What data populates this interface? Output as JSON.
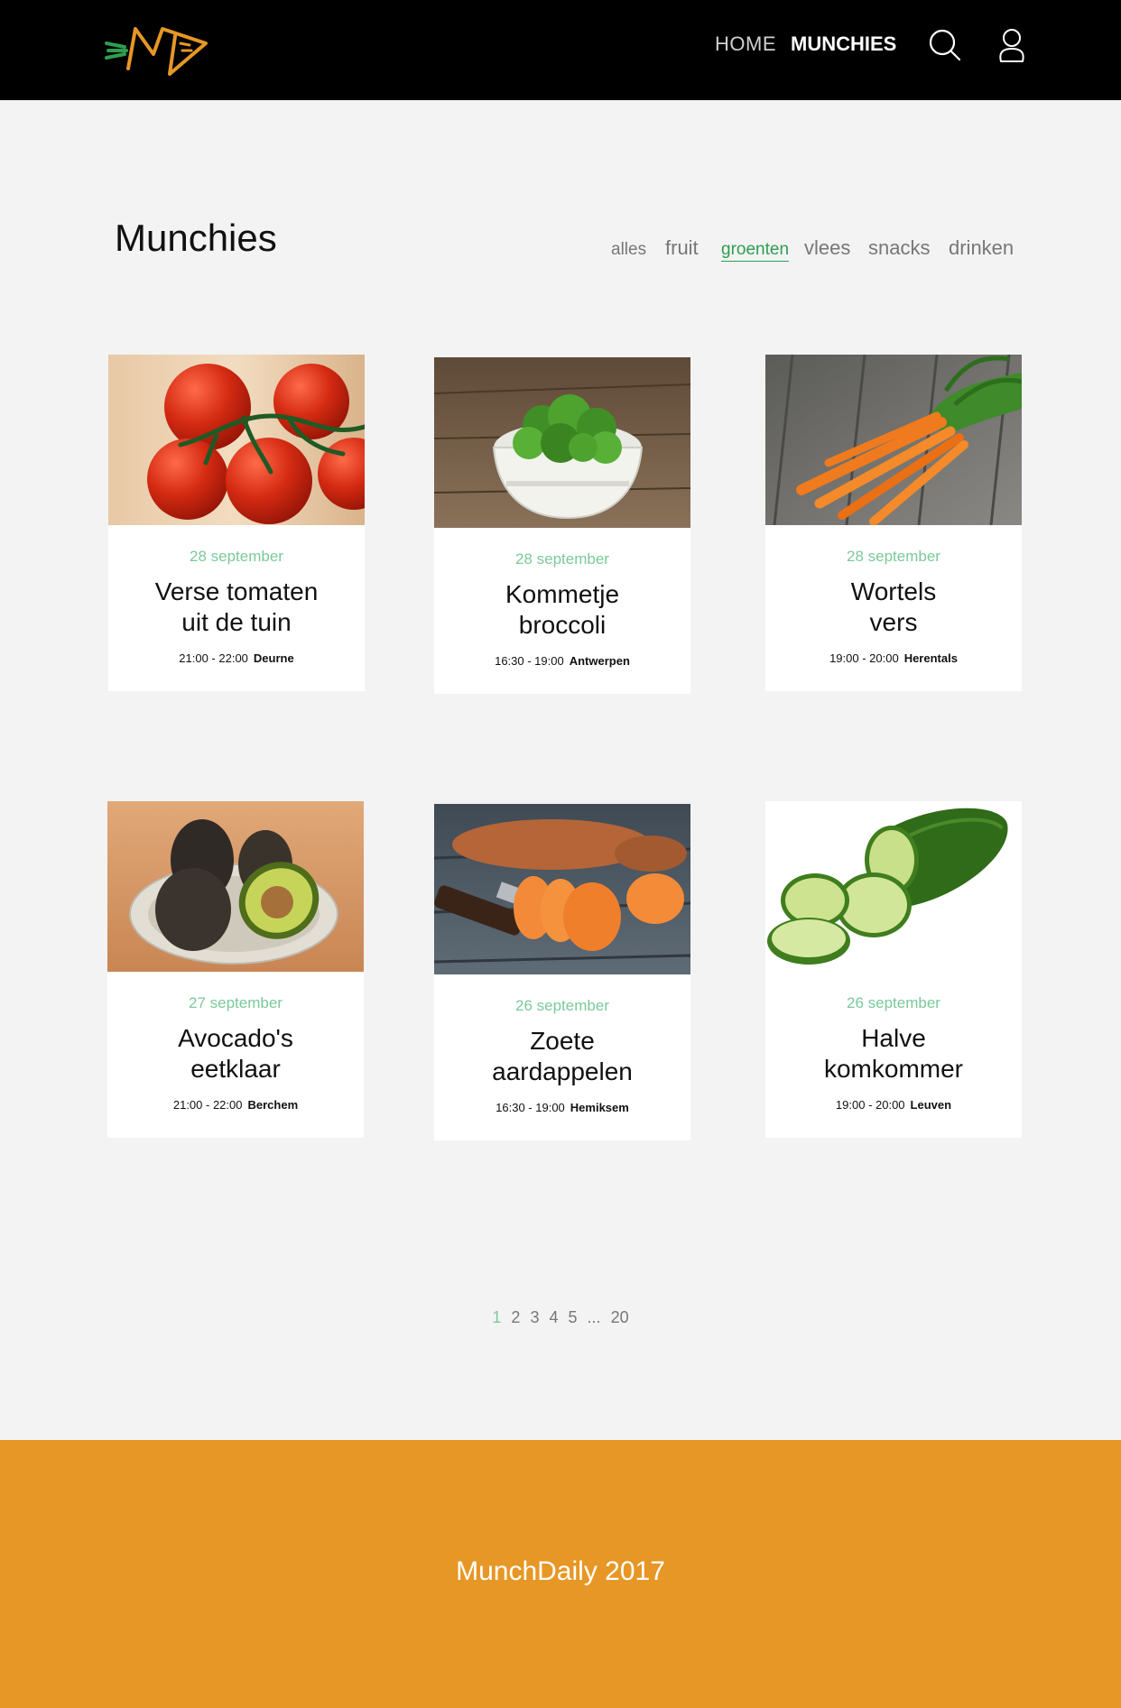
{
  "nav": {
    "home": "HOME",
    "munchies": "MUNCHIES",
    "accent": "#e69725"
  },
  "page": {
    "title": "Munchies",
    "filters": [
      "alles",
      "fruit",
      "groenten",
      "vlees",
      "snacks",
      "drinken"
    ],
    "active_filter": "groenten"
  },
  "cards": [
    {
      "date": "28 september",
      "title_line1": "Verse tomaten",
      "title_line2": "uit de tuin",
      "time": "21:00 - 22:00",
      "place": "Deurne",
      "image": "tomatoes"
    },
    {
      "date": "28 september",
      "title_line1": "Kommetje",
      "title_line2": "broccoli",
      "time": "16:30 - 19:00",
      "place": "Antwerpen",
      "image": "broccoli"
    },
    {
      "date": "28 september",
      "title_line1": "Wortels",
      "title_line2": "vers",
      "time": "19:00 - 20:00",
      "place": "Herentals",
      "image": "carrots"
    },
    {
      "date": "27 september",
      "title_line1": "Avocado's",
      "title_line2": "eetklaar",
      "time": "21:00 - 22:00",
      "place": "Berchem",
      "image": "avocados"
    },
    {
      "date": "26 september",
      "title_line1": "Zoete",
      "title_line2": "aardappelen",
      "time": "16:30 - 19:00",
      "place": "Hemiksem",
      "image": "sweet-potatoes"
    },
    {
      "date": "26 september",
      "title_line1": "Halve",
      "title_line2": "komkommer",
      "time": "19:00 - 20:00",
      "place": "Leuven",
      "image": "cucumber"
    }
  ],
  "pagination": {
    "pages": [
      "1",
      "2",
      "3",
      "4",
      "5",
      "...",
      "20"
    ],
    "current": "1"
  },
  "footer": {
    "text": "MunchDaily 2017"
  },
  "colors": {
    "topbar": "#000000",
    "background": "#f3f3f3",
    "active_filter": "#2e9e4f",
    "date": "#7bc99a",
    "footer": "#e69725"
  }
}
